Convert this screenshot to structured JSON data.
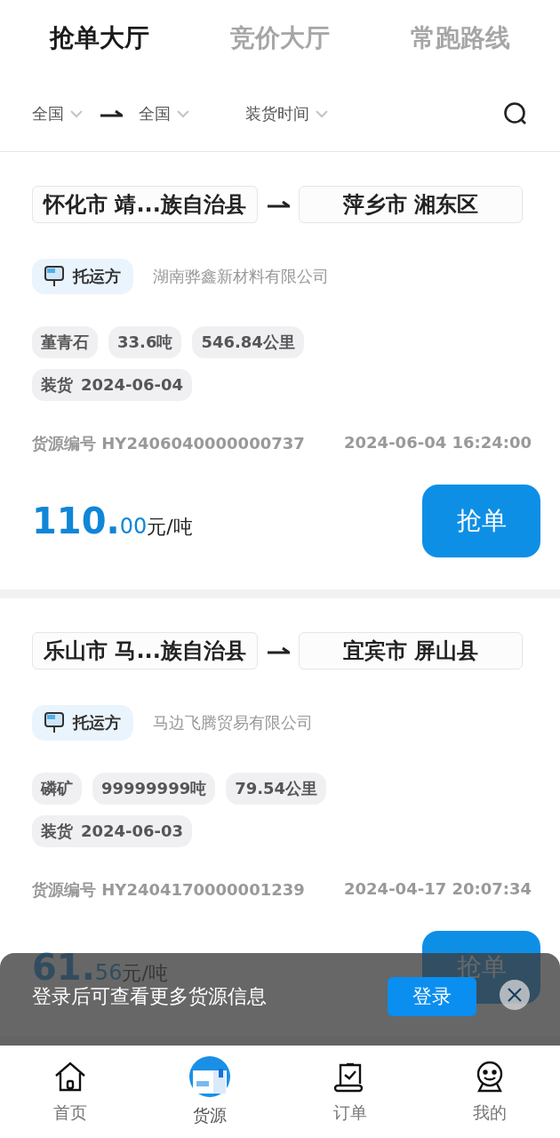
{
  "tabs": [
    {
      "label": "抢单大厅",
      "selected": true
    },
    {
      "label": "竞价大厅",
      "selected": false
    },
    {
      "label": "常跑路线",
      "selected": false
    }
  ],
  "filters": {
    "origin": "全国",
    "destination": "全国",
    "time": "装货时间"
  },
  "cards": [
    {
      "from": "怀化市 靖...族自治县",
      "to": "萍乡市 湘东区",
      "shipper_label": "托运方",
      "shipper": "湖南骅鑫新材料有限公司",
      "tags": [
        "堇青石",
        "33.6吨",
        "546.84公里"
      ],
      "load_label": "装货",
      "load_date": "2024-06-04",
      "id_label": "货源编号",
      "id": "HY2406040000000737",
      "time": "2024-06-04 16:24:00",
      "price_int": "110.",
      "price_dec": "00",
      "unit": "元/吨",
      "button": "抢单"
    },
    {
      "from": "乐山市 马...族自治县",
      "to": "宜宾市 屏山县",
      "shipper_label": "托运方",
      "shipper": "马边飞腾贸易有限公司",
      "tags": [
        "磷矿",
        "99999999吨",
        "79.54公里"
      ],
      "load_label": "装货",
      "load_date": "2024-06-03",
      "id_label": "货源编号",
      "id": "HY2404170000001239",
      "time": "2024-04-17 20:07:34",
      "price_int": "61.",
      "price_dec": "56",
      "unit": "元/吨",
      "button": "抢单"
    }
  ],
  "login_banner": {
    "message": "登录后可查看更多货源信息",
    "button": "登录"
  },
  "nav": [
    {
      "label": "首页",
      "kind": "home",
      "selected": false
    },
    {
      "label": "货源",
      "kind": "cargo",
      "selected": true
    },
    {
      "label": "订单",
      "kind": "order",
      "selected": false
    },
    {
      "label": "我的",
      "kind": "me",
      "selected": false
    }
  ]
}
